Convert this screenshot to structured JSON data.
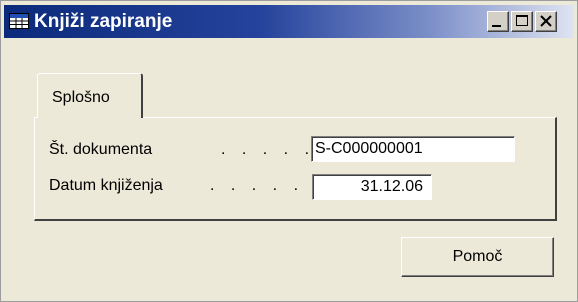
{
  "window": {
    "title": "Knjiži zapiranje",
    "icon": "table-window-icon",
    "title_colors": {
      "start": "#0b2a7a",
      "end": "#dfe4f2"
    }
  },
  "caption_buttons": {
    "minimize": "minimize-icon",
    "maximize": "maximize-icon",
    "close": "close-icon"
  },
  "tabs": [
    {
      "label": "Splošno",
      "selected": true
    }
  ],
  "form": {
    "document_no": {
      "label": "Št. dokumenta",
      "dots": ". . . . .",
      "value": "S-C000000001"
    },
    "posting_date": {
      "label": "Datum knjiženja",
      "dots": ". . . . .",
      "value": "31.12.06"
    }
  },
  "buttons": {
    "help": "Pomoč"
  }
}
